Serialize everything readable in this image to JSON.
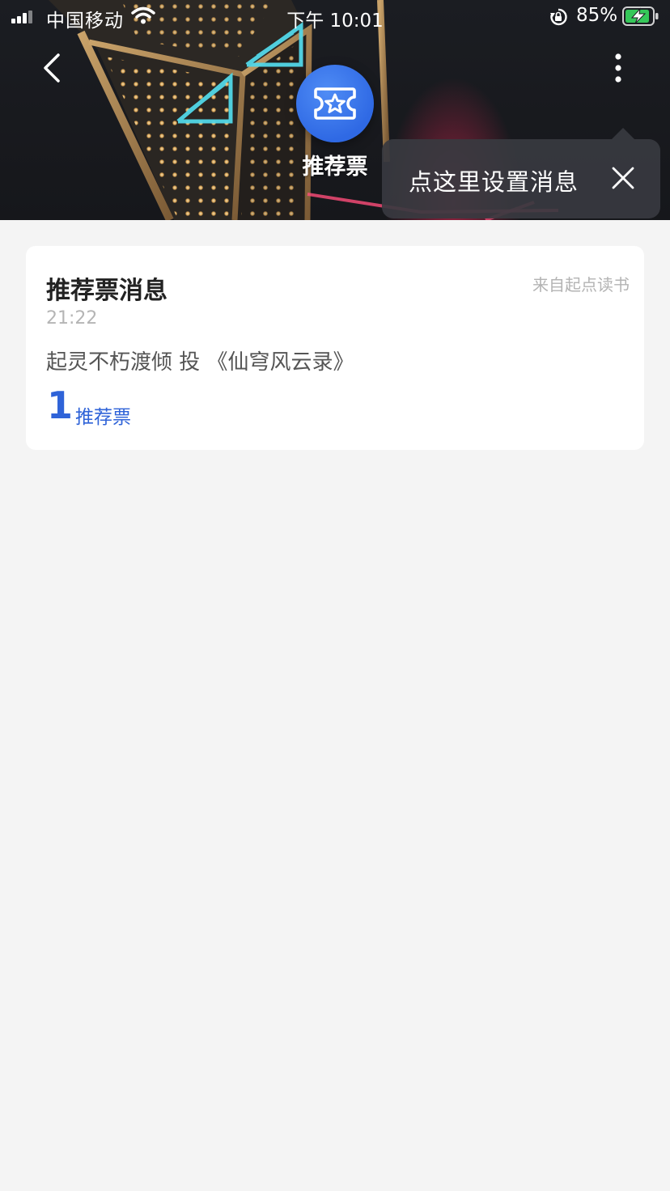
{
  "status_bar": {
    "carrier": "中国移动",
    "time": "下午 10:01",
    "battery": "85%"
  },
  "header": {
    "title": "推荐票",
    "back_icon": "chevron-left-icon",
    "more_icon": "more-vertical-icon",
    "badge_icon": "ticket-star-icon"
  },
  "tooltip": {
    "text": "点这里设置消息",
    "close_icon": "close-icon"
  },
  "message": {
    "title": "推荐票消息",
    "source": "来自起点读书",
    "timestamp": "21:22",
    "text": "起灵不朽渡倾 投 《仙穹风云录》",
    "count": "1",
    "count_unit": "推荐票"
  },
  "colors": {
    "accent": "#2f63d8",
    "badge": "#3a76ea",
    "background": "#f4f4f4"
  }
}
